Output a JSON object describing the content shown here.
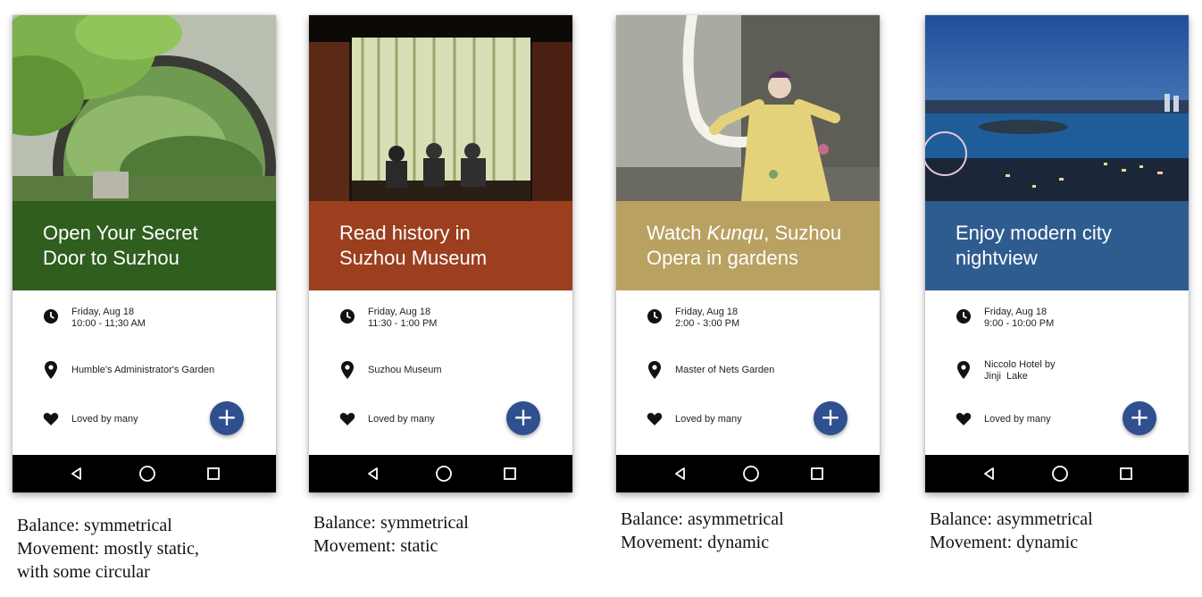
{
  "cards": [
    {
      "title_parts": [
        "Open Your Secret",
        "Door to Suzhou"
      ],
      "banner_color": "#2f5e1f",
      "date": "Friday, Aug 18",
      "time": "10:00 - 11;30 AM",
      "location_lines": [
        "Humble's Administrator's Garden"
      ],
      "likes": "Loved by many",
      "caption_lines": [
        "Balance: symmetrical",
        "Movement: mostly static,",
        "with some circular"
      ]
    },
    {
      "title_parts": [
        "Read history in",
        "Suzhou Museum"
      ],
      "banner_color": "#9b3f1f",
      "date": "Friday, Aug 18",
      "time": "11:30 - 1:00 PM",
      "location_lines": [
        "Suzhou Museum"
      ],
      "likes": "Loved by many",
      "caption_lines": [
        "Balance: symmetrical",
        "Movement: static"
      ]
    },
    {
      "title_line1_a": "Watch ",
      "title_line1_em": "Kunqu",
      "title_line1_b": ", Suzhou",
      "title_line2": "Opera in gardens",
      "banner_color": "#b9a162",
      "date": "Friday, Aug 18",
      "time": "2:00 - 3:00 PM",
      "location_lines": [
        "Master of Nets Garden"
      ],
      "likes": "Loved by many",
      "caption_lines": [
        "Balance: asymmetrical",
        "Movement: dynamic"
      ]
    },
    {
      "title_parts": [
        "Enjoy modern city",
        "nightview"
      ],
      "banner_color": "#2f5c8f",
      "date": "Friday, Aug 18",
      "time": "9:00 - 10:00 PM",
      "location_lines": [
        "Niccolo Hotel by",
        "Jinji  Lake"
      ],
      "likes": "Loved by many",
      "caption_lines": [
        "Balance: asymmetrical",
        "Movement: dynamic"
      ]
    }
  ],
  "fab_glyph": "+",
  "accent_fab": "#2f4f8e",
  "icons": {
    "time": "clock-icon",
    "location": "location-pin-icon",
    "likes": "heart-icon",
    "add": "plus-icon",
    "nav": [
      "back-icon",
      "home-icon",
      "recents-icon"
    ]
  }
}
